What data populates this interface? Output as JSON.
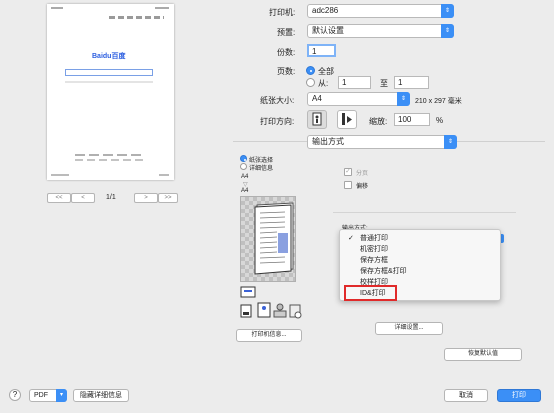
{
  "preview": {
    "page_label": "1/1",
    "logo_text": "Baidu百度",
    "first_label": "<<",
    "prev_label": "<",
    "next_label": ">",
    "last_label": ">>"
  },
  "printer": {
    "label": "打印机:",
    "value": "adc286"
  },
  "preset": {
    "label": "预置:",
    "value": "默认设置"
  },
  "copies": {
    "label": "份数:",
    "value": "1"
  },
  "pages": {
    "label": "页数:",
    "all_label": "全部",
    "from_label": "从:",
    "from_value": "1",
    "to_label": "至",
    "to_value": "1"
  },
  "paper": {
    "label": "纸张大小:",
    "value": "A4",
    "dims": "210 x 297 毫米"
  },
  "orientation": {
    "label": "打印方向:",
    "scale_label": "缩放:",
    "scale_value": "100",
    "scale_unit": "%"
  },
  "section_popup": {
    "value": "输出方式"
  },
  "paper_settings": {
    "radio_device": "纸张选择",
    "radio_detail": "详细信息",
    "size_top": "A4",
    "size_bottom": "A4",
    "print_info_button": "打印机信息..."
  },
  "options": {
    "collate_label": "分页",
    "offset_label": "偏移",
    "output_label": "输出方式:",
    "details_button": "详细设置...",
    "restore_button": "恢复默认值"
  },
  "menu": {
    "items": [
      "普通打印",
      "机密打印",
      "保存方框",
      "保存方框&打印",
      "校样打印",
      "ID&打印"
    ],
    "checked_index": 0
  },
  "footer": {
    "help_label": "?",
    "pdf_label": "PDF",
    "hide_details_label": "隐藏详细信息",
    "cancel_label": "取消",
    "print_label": "打印"
  },
  "colors": {
    "accent": "#3b8ff6",
    "highlight": "#e02a2a"
  }
}
